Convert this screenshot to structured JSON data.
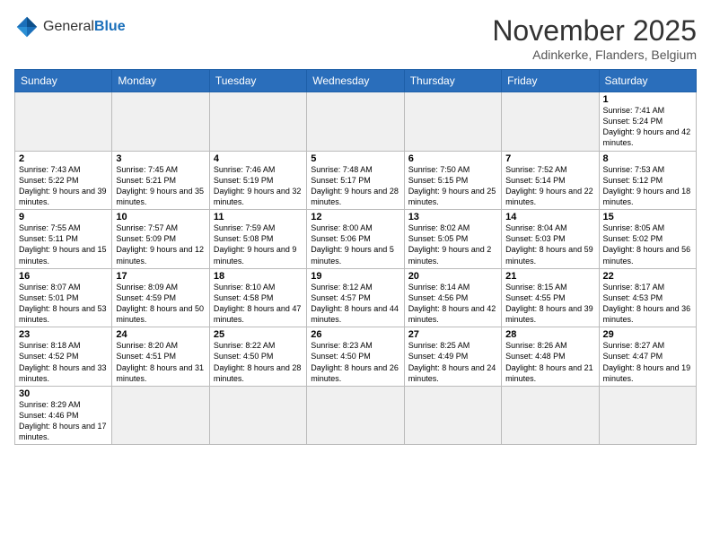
{
  "header": {
    "logo_general": "General",
    "logo_blue": "Blue",
    "title": "November 2025",
    "subtitle": "Adinkerke, Flanders, Belgium"
  },
  "days_of_week": [
    "Sunday",
    "Monday",
    "Tuesday",
    "Wednesday",
    "Thursday",
    "Friday",
    "Saturday"
  ],
  "weeks": [
    [
      {
        "day": "",
        "info": ""
      },
      {
        "day": "",
        "info": ""
      },
      {
        "day": "",
        "info": ""
      },
      {
        "day": "",
        "info": ""
      },
      {
        "day": "",
        "info": ""
      },
      {
        "day": "",
        "info": ""
      },
      {
        "day": "1",
        "info": "Sunrise: 7:41 AM\nSunset: 5:24 PM\nDaylight: 9 hours and 42 minutes."
      }
    ],
    [
      {
        "day": "2",
        "info": "Sunrise: 7:43 AM\nSunset: 5:22 PM\nDaylight: 9 hours and 39 minutes."
      },
      {
        "day": "3",
        "info": "Sunrise: 7:45 AM\nSunset: 5:21 PM\nDaylight: 9 hours and 35 minutes."
      },
      {
        "day": "4",
        "info": "Sunrise: 7:46 AM\nSunset: 5:19 PM\nDaylight: 9 hours and 32 minutes."
      },
      {
        "day": "5",
        "info": "Sunrise: 7:48 AM\nSunset: 5:17 PM\nDaylight: 9 hours and 28 minutes."
      },
      {
        "day": "6",
        "info": "Sunrise: 7:50 AM\nSunset: 5:15 PM\nDaylight: 9 hours and 25 minutes."
      },
      {
        "day": "7",
        "info": "Sunrise: 7:52 AM\nSunset: 5:14 PM\nDaylight: 9 hours and 22 minutes."
      },
      {
        "day": "8",
        "info": "Sunrise: 7:53 AM\nSunset: 5:12 PM\nDaylight: 9 hours and 18 minutes."
      }
    ],
    [
      {
        "day": "9",
        "info": "Sunrise: 7:55 AM\nSunset: 5:11 PM\nDaylight: 9 hours and 15 minutes."
      },
      {
        "day": "10",
        "info": "Sunrise: 7:57 AM\nSunset: 5:09 PM\nDaylight: 9 hours and 12 minutes."
      },
      {
        "day": "11",
        "info": "Sunrise: 7:59 AM\nSunset: 5:08 PM\nDaylight: 9 hours and 9 minutes."
      },
      {
        "day": "12",
        "info": "Sunrise: 8:00 AM\nSunset: 5:06 PM\nDaylight: 9 hours and 5 minutes."
      },
      {
        "day": "13",
        "info": "Sunrise: 8:02 AM\nSunset: 5:05 PM\nDaylight: 9 hours and 2 minutes."
      },
      {
        "day": "14",
        "info": "Sunrise: 8:04 AM\nSunset: 5:03 PM\nDaylight: 8 hours and 59 minutes."
      },
      {
        "day": "15",
        "info": "Sunrise: 8:05 AM\nSunset: 5:02 PM\nDaylight: 8 hours and 56 minutes."
      }
    ],
    [
      {
        "day": "16",
        "info": "Sunrise: 8:07 AM\nSunset: 5:01 PM\nDaylight: 8 hours and 53 minutes."
      },
      {
        "day": "17",
        "info": "Sunrise: 8:09 AM\nSunset: 4:59 PM\nDaylight: 8 hours and 50 minutes."
      },
      {
        "day": "18",
        "info": "Sunrise: 8:10 AM\nSunset: 4:58 PM\nDaylight: 8 hours and 47 minutes."
      },
      {
        "day": "19",
        "info": "Sunrise: 8:12 AM\nSunset: 4:57 PM\nDaylight: 8 hours and 44 minutes."
      },
      {
        "day": "20",
        "info": "Sunrise: 8:14 AM\nSunset: 4:56 PM\nDaylight: 8 hours and 42 minutes."
      },
      {
        "day": "21",
        "info": "Sunrise: 8:15 AM\nSunset: 4:55 PM\nDaylight: 8 hours and 39 minutes."
      },
      {
        "day": "22",
        "info": "Sunrise: 8:17 AM\nSunset: 4:53 PM\nDaylight: 8 hours and 36 minutes."
      }
    ],
    [
      {
        "day": "23",
        "info": "Sunrise: 8:18 AM\nSunset: 4:52 PM\nDaylight: 8 hours and 33 minutes."
      },
      {
        "day": "24",
        "info": "Sunrise: 8:20 AM\nSunset: 4:51 PM\nDaylight: 8 hours and 31 minutes."
      },
      {
        "day": "25",
        "info": "Sunrise: 8:22 AM\nSunset: 4:50 PM\nDaylight: 8 hours and 28 minutes."
      },
      {
        "day": "26",
        "info": "Sunrise: 8:23 AM\nSunset: 4:50 PM\nDaylight: 8 hours and 26 minutes."
      },
      {
        "day": "27",
        "info": "Sunrise: 8:25 AM\nSunset: 4:49 PM\nDaylight: 8 hours and 24 minutes."
      },
      {
        "day": "28",
        "info": "Sunrise: 8:26 AM\nSunset: 4:48 PM\nDaylight: 8 hours and 21 minutes."
      },
      {
        "day": "29",
        "info": "Sunrise: 8:27 AM\nSunset: 4:47 PM\nDaylight: 8 hours and 19 minutes."
      }
    ],
    [
      {
        "day": "30",
        "info": "Sunrise: 8:29 AM\nSunset: 4:46 PM\nDaylight: 8 hours and 17 minutes."
      },
      {
        "day": "",
        "info": ""
      },
      {
        "day": "",
        "info": ""
      },
      {
        "day": "",
        "info": ""
      },
      {
        "day": "",
        "info": ""
      },
      {
        "day": "",
        "info": ""
      },
      {
        "day": "",
        "info": ""
      }
    ]
  ]
}
